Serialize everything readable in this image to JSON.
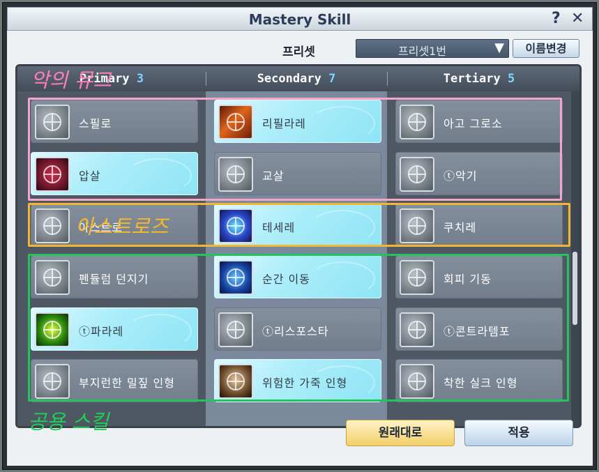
{
  "window": {
    "title": "Mastery Skill",
    "help_label": "?",
    "close_label": "✕"
  },
  "preset": {
    "label": "프리셋",
    "selected": "프리셋1번",
    "arrow": "▼",
    "rename_label": "이름변경"
  },
  "columns": [
    {
      "name": "Primary",
      "count": "3"
    },
    {
      "name": "Secondary",
      "count": "7"
    },
    {
      "name": "Tertiary",
      "count": "5"
    }
  ],
  "skills": {
    "primary": [
      {
        "label": "스필로",
        "active": false,
        "icon": "claw-slash-icon"
      },
      {
        "label": "압살",
        "active": true,
        "icon": "crimson-crush-icon"
      },
      {
        "label": "아스트로",
        "active": false,
        "icon": "swirl-slash-icon"
      },
      {
        "label": "펜듈럼 던지기",
        "active": false,
        "icon": "pendulum-throw-icon"
      },
      {
        "label": "ⓣ파라레",
        "active": true,
        "icon": "green-rune-icon"
      },
      {
        "label": "부지런한 밀짚 인형",
        "active": false,
        "icon": "straw-doll-icon"
      }
    ],
    "secondary": [
      {
        "label": "리필라레",
        "active": true,
        "icon": "fire-lattice-icon"
      },
      {
        "label": "교살",
        "active": false,
        "icon": "strangle-icon"
      },
      {
        "label": "테세레",
        "active": true,
        "icon": "blue-sigil-icon"
      },
      {
        "label": "순간 이동",
        "active": true,
        "icon": "teleport-icon"
      },
      {
        "label": "ⓣ리스포스타",
        "active": false,
        "icon": "mandala-icon"
      },
      {
        "label": "위험한 가죽 인형",
        "active": true,
        "icon": "leather-doll-icon"
      }
    ],
    "tertiary": [
      {
        "label": "아고 그로소",
        "active": false,
        "icon": "needle-icon"
      },
      {
        "label": "ⓣ악기",
        "active": false,
        "icon": "instrument-icon"
      },
      {
        "label": "쿠치레",
        "active": false,
        "icon": "burst-icon"
      },
      {
        "label": "회피 기동",
        "active": false,
        "icon": "evade-star-icon"
      },
      {
        "label": "ⓣ콘트라템포",
        "active": false,
        "icon": "spiral-mandala-icon"
      },
      {
        "label": "착한 실크 인형",
        "active": false,
        "icon": "silk-doll-icon"
      }
    ]
  },
  "annotations": {
    "pink": "악의 뮤그",
    "yellow": "아스트로즈",
    "green": "공용 스킬"
  },
  "buttons": {
    "reset_label": "원래대로",
    "apply_label": "적용"
  },
  "colors": {
    "active_slot": "#aeeefa",
    "inactive_slot": "#7c8795",
    "annotation_pink": "#ff7eb8",
    "annotation_yellow": "#f5b82a",
    "annotation_green": "#1fcf58",
    "count_blue": "#7ad6ff"
  }
}
